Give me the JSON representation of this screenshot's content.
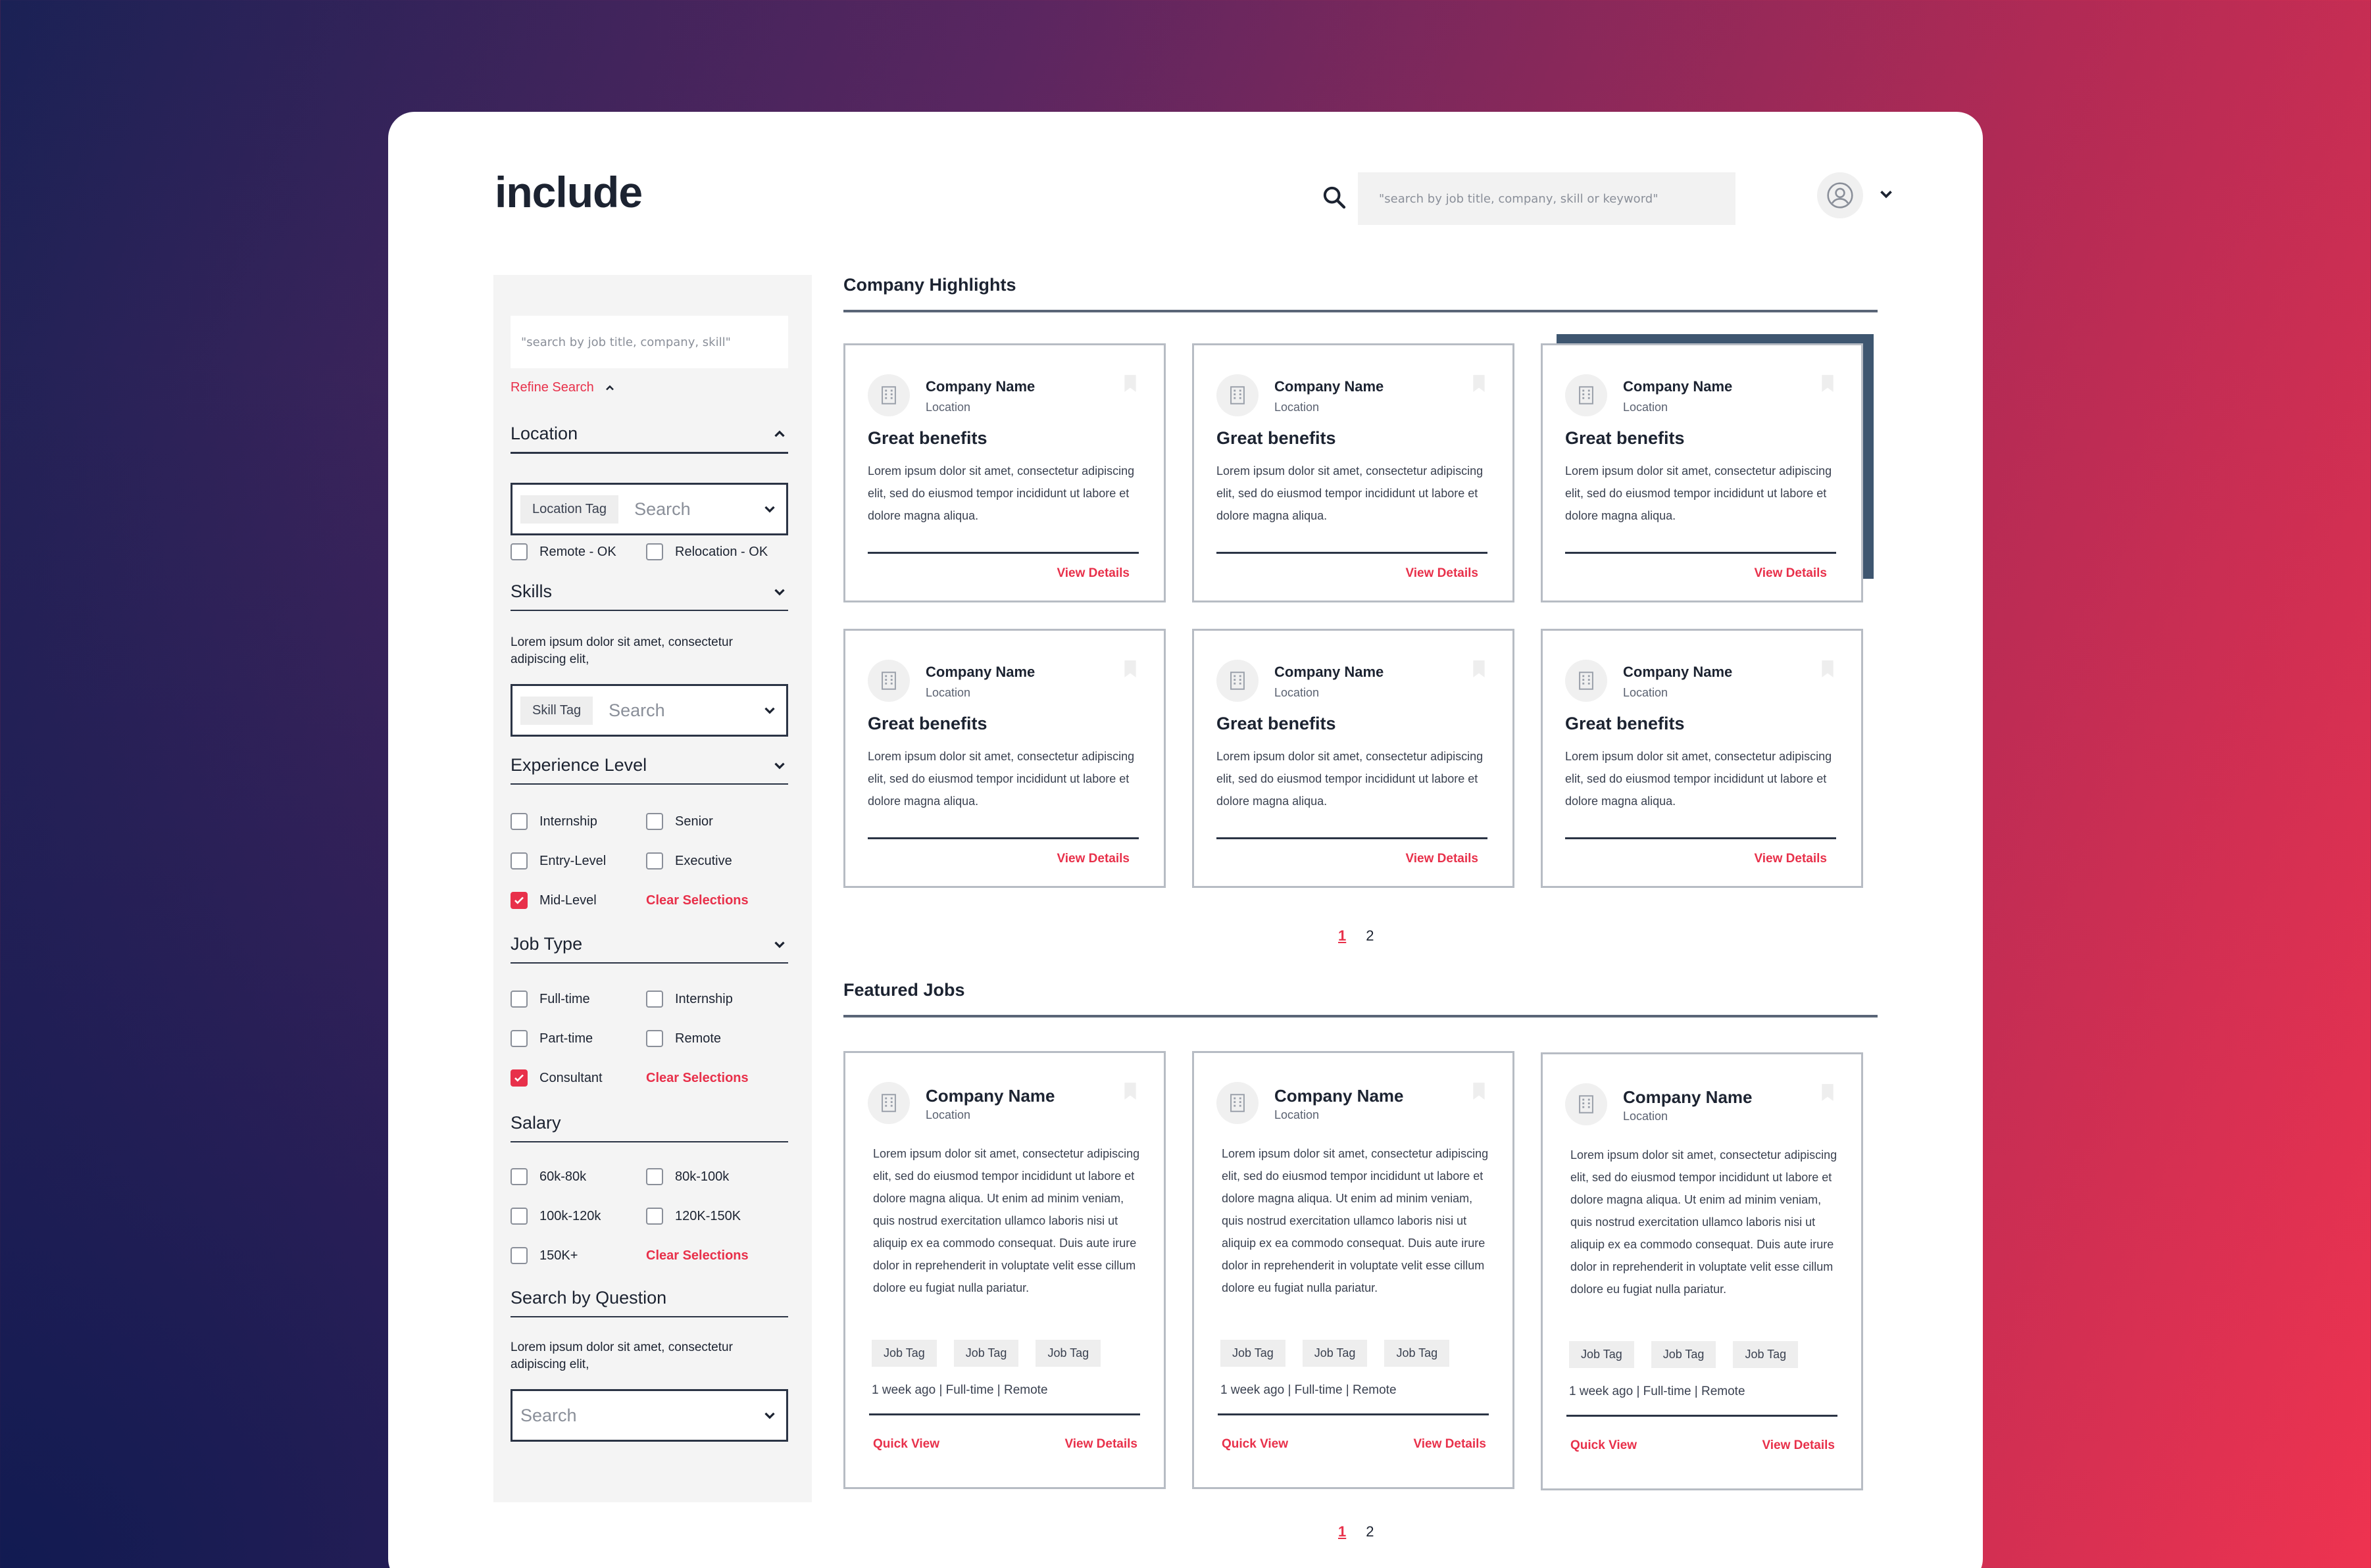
{
  "app": {
    "logo": "include"
  },
  "header": {
    "search_placeholder": "\"search by job title, company, skill or keyword\""
  },
  "sidebar": {
    "search_placeholder": "\"search by job title, company, skill\"",
    "refine_label": "Refine Search",
    "location": {
      "title": "Location",
      "tag": "Location Tag",
      "placeholder": "Search",
      "remote": "Remote - OK",
      "relocation": "Relocation - OK"
    },
    "skills": {
      "title": "Skills",
      "desc": "Lorem ipsum dolor sit amet, consectetur adipiscing elit,",
      "tag": "Skill Tag",
      "placeholder": "Search"
    },
    "experience": {
      "title": "Experience Level",
      "opts": [
        "Internship",
        "Senior",
        "Entry-Level",
        "Executive",
        "Mid-Level"
      ],
      "clear": "Clear Selections"
    },
    "jobtype": {
      "title": "Job Type",
      "opts": [
        "Full-time",
        "Internship",
        "Part-time",
        "Remote",
        "Consultant"
      ],
      "clear": "Clear Selections"
    },
    "salary": {
      "title": "Salary",
      "opts": [
        "60k-80k",
        "80k-100k",
        "100k-120k",
        "120K-150K",
        "150K+"
      ],
      "clear": "Clear Selections"
    },
    "question": {
      "title": "Search by Question",
      "desc": "Lorem ipsum dolor sit amet, consectetur adipiscing elit,",
      "placeholder": "Search"
    }
  },
  "highlights": {
    "title": "Company Highlights",
    "card": {
      "company": "Company Name",
      "location": "Location",
      "heading": "Great benefits",
      "body": "Lorem ipsum dolor sit amet, consectetur adipiscing elit, sed do eiusmod tempor incididunt ut labore et dolore magna aliqua.",
      "link": "View Details"
    },
    "pages": [
      "1",
      "2"
    ]
  },
  "featured": {
    "title": "Featured Jobs",
    "card": {
      "company": "Company Name",
      "location": "Location",
      "body": "Lorem ipsum dolor sit amet, consectetur adipiscing elit, sed do eiusmod tempor incididunt ut labore et dolore magna aliqua. Ut enim ad minim veniam, quis nostrud exercitation ullamco laboris nisi ut aliquip ex ea commodo consequat. Duis aute irure dolor in reprehenderit in voluptate velit esse cillum dolore eu fugiat nulla pariatur.",
      "tags": [
        "Job Tag",
        "Job Tag",
        "Job Tag"
      ],
      "meta": "1 week ago | Full-time | Remote",
      "quick": "Quick View",
      "link": "View Details"
    },
    "pages": [
      "1",
      "2"
    ]
  },
  "colors": {
    "accent": "#e8304a",
    "dark": "#1c2331",
    "highlight": "#3e5670"
  }
}
